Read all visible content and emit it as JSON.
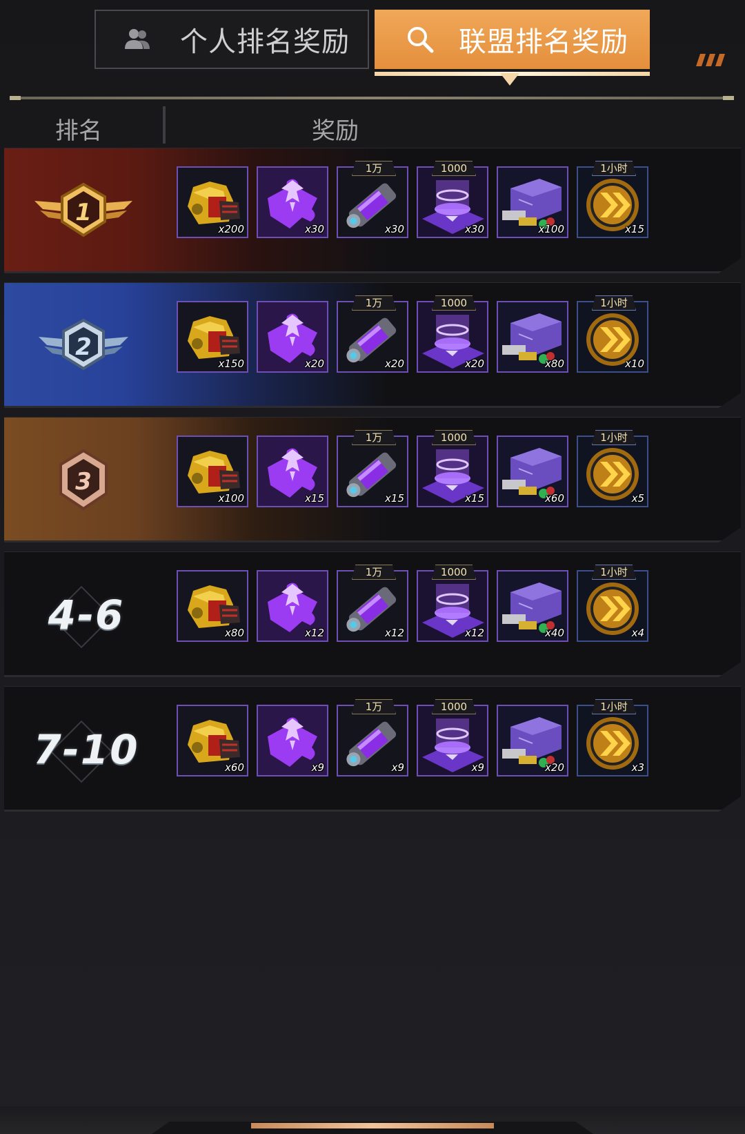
{
  "tabs": {
    "personal": {
      "label": "个人排名奖励",
      "icon": "people-icon"
    },
    "alliance": {
      "label": "联盟排名奖励",
      "icon": "search-icon",
      "selected": true
    }
  },
  "header": {
    "rank": "排名",
    "reward": "奖励"
  },
  "colors": {
    "accent": "#e89a48",
    "item_border": "#6d4fb5"
  },
  "rows": [
    {
      "rank": "1",
      "rank_type": "gold-medal",
      "rewards": [
        {
          "icon": "mech-armor-chest-icon",
          "qty": "x200"
        },
        {
          "icon": "purple-puzzle-icon",
          "qty": "x30"
        },
        {
          "icon": "purple-tube-icon",
          "tag": "1万",
          "qty": "x30"
        },
        {
          "icon": "purple-platform-icon",
          "tag": "1000",
          "qty": "x30"
        },
        {
          "icon": "supply-crate-icon",
          "qty": "x100"
        },
        {
          "icon": "speedup-icon",
          "tag": "1小时",
          "qty": "x15"
        }
      ]
    },
    {
      "rank": "2",
      "rank_type": "silver-medal",
      "rewards": [
        {
          "icon": "mech-armor-chest-icon",
          "qty": "x150"
        },
        {
          "icon": "purple-puzzle-icon",
          "qty": "x20"
        },
        {
          "icon": "purple-tube-icon",
          "tag": "1万",
          "qty": "x20"
        },
        {
          "icon": "purple-platform-icon",
          "tag": "1000",
          "qty": "x20"
        },
        {
          "icon": "supply-crate-icon",
          "qty": "x80"
        },
        {
          "icon": "speedup-icon",
          "tag": "1小时",
          "qty": "x10"
        }
      ]
    },
    {
      "rank": "3",
      "rank_type": "bronze-medal",
      "rewards": [
        {
          "icon": "mech-armor-chest-icon",
          "qty": "x100"
        },
        {
          "icon": "purple-puzzle-icon",
          "qty": "x15"
        },
        {
          "icon": "purple-tube-icon",
          "tag": "1万",
          "qty": "x15"
        },
        {
          "icon": "purple-platform-icon",
          "tag": "1000",
          "qty": "x15"
        },
        {
          "icon": "supply-crate-icon",
          "qty": "x60"
        },
        {
          "icon": "speedup-icon",
          "tag": "1小时",
          "qty": "x5"
        }
      ]
    },
    {
      "rank": "4-6",
      "rank_type": "text",
      "rewards": [
        {
          "icon": "mech-armor-chest-icon",
          "qty": "x80"
        },
        {
          "icon": "purple-puzzle-icon",
          "qty": "x12"
        },
        {
          "icon": "purple-tube-icon",
          "tag": "1万",
          "qty": "x12"
        },
        {
          "icon": "purple-platform-icon",
          "tag": "1000",
          "qty": "x12"
        },
        {
          "icon": "supply-crate-icon",
          "qty": "x40"
        },
        {
          "icon": "speedup-icon",
          "tag": "1小时",
          "qty": "x4"
        }
      ]
    },
    {
      "rank": "7-10",
      "rank_type": "text",
      "rewards": [
        {
          "icon": "mech-armor-chest-icon",
          "qty": "x60"
        },
        {
          "icon": "purple-puzzle-icon",
          "qty": "x9"
        },
        {
          "icon": "purple-tube-icon",
          "tag": "1万",
          "qty": "x9"
        },
        {
          "icon": "purple-platform-icon",
          "tag": "1000",
          "qty": "x9"
        },
        {
          "icon": "supply-crate-icon",
          "qty": "x20"
        },
        {
          "icon": "speedup-icon",
          "tag": "1小时",
          "qty": "x3"
        }
      ]
    }
  ]
}
